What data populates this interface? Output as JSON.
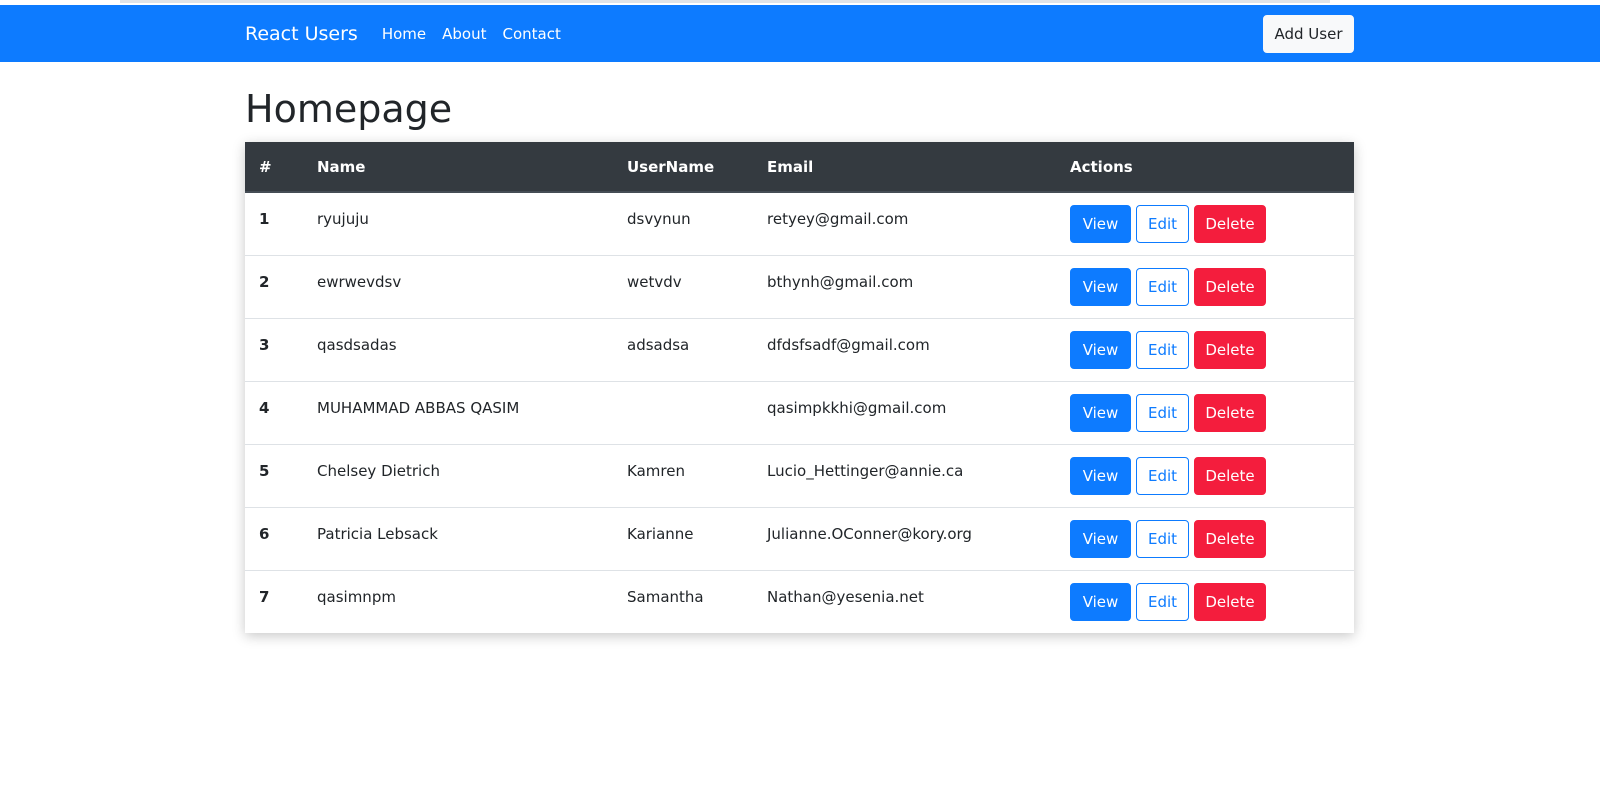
{
  "navbar": {
    "brand": "React Users",
    "links": [
      "Home",
      "About",
      "Contact"
    ],
    "add_user_label": "Add User",
    "color": "#0d7bff"
  },
  "page": {
    "title": "Homepage"
  },
  "table": {
    "headers": [
      "#",
      "Name",
      "UserName",
      "Email",
      "Actions"
    ],
    "rows": [
      {
        "index": "1",
        "name": "ryujuju",
        "username": "dsvynun",
        "email": "retyey@gmail.com"
      },
      {
        "index": "2",
        "name": "ewrwevdsv",
        "username": "wetvdv",
        "email": "bthynh@gmail.com"
      },
      {
        "index": "3",
        "name": "qasdsadas",
        "username": "adsadsa",
        "email": "dfdsfsadf@gmail.com"
      },
      {
        "index": "4",
        "name": "MUHAMMAD ABBAS QASIM",
        "username": "",
        "email": "qasimpkkhi@gmail.com"
      },
      {
        "index": "5",
        "name": "Chelsey Dietrich",
        "username": "Kamren",
        "email": "Lucio_Hettinger@annie.ca"
      },
      {
        "index": "6",
        "name": "Patricia Lebsack",
        "username": "Karianne",
        "email": "Julianne.OConner@kory.org"
      },
      {
        "index": "7",
        "name": "qasimnpm",
        "username": "Samantha",
        "email": "Nathan@yesenia.net"
      }
    ],
    "actions": {
      "view": "View",
      "edit": "Edit",
      "delete": "Delete"
    }
  },
  "colors": {
    "primary": "#0d7bff",
    "danger": "#f41d3d",
    "table_header": "#343a40"
  }
}
